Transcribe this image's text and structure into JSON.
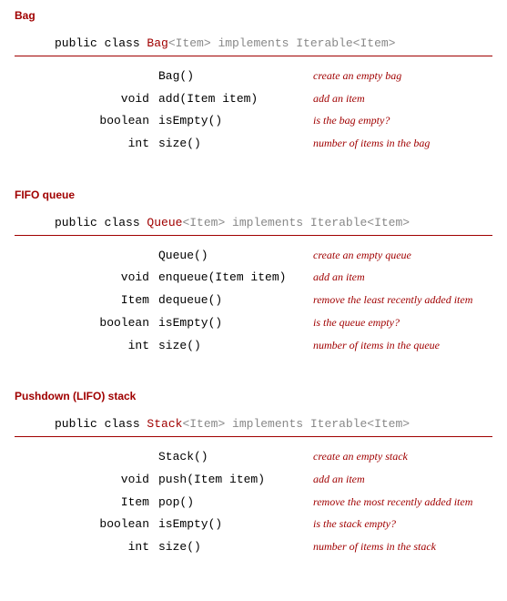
{
  "sections": [
    {
      "title": "Bag",
      "sig": {
        "kw": "public class",
        "cls": "Bag",
        "tpl": "<Item>",
        "impl": " implements Iterable<Item>"
      },
      "methods": [
        {
          "ret": "",
          "sig": "Bag()",
          "desc": "create an empty bag"
        },
        {
          "ret": "void",
          "sig": "add(Item item)",
          "desc": "add an item"
        },
        {
          "ret": "boolean",
          "sig": "isEmpty()",
          "desc": "is the bag empty?"
        },
        {
          "ret": "int",
          "sig": "size()",
          "desc": "number of items in the bag"
        }
      ]
    },
    {
      "title": "FIFO queue",
      "sig": {
        "kw": "public class",
        "cls": "Queue",
        "tpl": "<Item>",
        "impl": " implements Iterable<Item>"
      },
      "methods": [
        {
          "ret": "",
          "sig": "Queue()",
          "desc": "create an empty queue"
        },
        {
          "ret": "void",
          "sig": "enqueue(Item item)",
          "desc": "add an item"
        },
        {
          "ret": "Item",
          "sig": "dequeue()",
          "desc": "remove the least recently added item"
        },
        {
          "ret": "boolean",
          "sig": "isEmpty()",
          "desc": "is the queue empty?"
        },
        {
          "ret": "int",
          "sig": "size()",
          "desc": "number of items in the queue"
        }
      ]
    },
    {
      "title": "Pushdown (LIFO) stack",
      "sig": {
        "kw": "public class",
        "cls": "Stack",
        "tpl": "<Item>",
        "impl": " implements Iterable<Item>"
      },
      "methods": [
        {
          "ret": "",
          "sig": "Stack()",
          "desc": "create an empty stack"
        },
        {
          "ret": "void",
          "sig": "push(Item item)",
          "desc": "add an item"
        },
        {
          "ret": "Item",
          "sig": "pop()",
          "desc": "remove the most recently added item"
        },
        {
          "ret": "boolean",
          "sig": "isEmpty()",
          "desc": "is the stack empty?"
        },
        {
          "ret": "int",
          "sig": "size()",
          "desc": "number of items in the stack"
        }
      ]
    }
  ]
}
